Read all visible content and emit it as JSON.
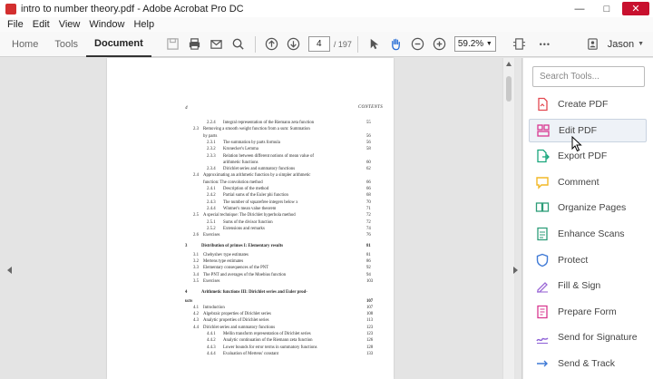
{
  "window": {
    "title": "intro to number theory.pdf - Adobe Acrobat Pro DC",
    "minimize": "—",
    "maximize": "□",
    "close": "✕"
  },
  "menu": [
    "File",
    "Edit",
    "View",
    "Window",
    "Help"
  ],
  "toolbar": {
    "tabs": [
      "Home",
      "Tools",
      "Document"
    ],
    "active_tab": "Document",
    "page_current": "4",
    "page_total": "/ 197",
    "zoom": "59.2%",
    "more": "•••",
    "user": "Jason"
  },
  "document": {
    "page_number": "4",
    "running_title": "CONTENTS",
    "toc": [
      {
        "num": "2.2.4",
        "title": "Integral representation of the Riemann zeta function",
        "page": "55",
        "level": 3
      },
      {
        "num": "2.3",
        "title": "Removing a smooth weight function from a sum: Summation",
        "page": "",
        "level": 2
      },
      {
        "num": "",
        "title": "by parts",
        "page": "56",
        "level": 2
      },
      {
        "num": "2.3.1",
        "title": "The summation by parts formula",
        "page": "56",
        "level": 3
      },
      {
        "num": "2.3.2",
        "title": "Kronecker's Lemma",
        "page": "58",
        "level": 3
      },
      {
        "num": "2.3.3",
        "title": "Relation between different notions of mean value of",
        "page": "",
        "level": 3
      },
      {
        "num": "",
        "title": "arithmetic functions",
        "page": "60",
        "level": 3
      },
      {
        "num": "2.3.4",
        "title": "Dirichlet series and summatory functions",
        "page": "62",
        "level": 3
      },
      {
        "num": "2.4",
        "title": "Approximating an arithmetic function by a simpler arithmetic",
        "page": "",
        "level": 2
      },
      {
        "num": "",
        "title": "function: The convolution method",
        "page": "66",
        "level": 2
      },
      {
        "num": "2.4.1",
        "title": "Description of the method",
        "page": "66",
        "level": 3
      },
      {
        "num": "2.4.2",
        "title": "Partial sums of the Euler phi function",
        "page": "68",
        "level": 3
      },
      {
        "num": "2.4.3",
        "title": "The number of squarefree integers below x",
        "page": "70",
        "level": 3
      },
      {
        "num": "2.4.4",
        "title": "Wintner's mean value theorem",
        "page": "71",
        "level": 3
      },
      {
        "num": "2.5",
        "title": "A special technique: The Dirichlet hyperbola method",
        "page": "72",
        "level": 2
      },
      {
        "num": "2.5.1",
        "title": "Sums of the divisor function",
        "page": "72",
        "level": 3
      },
      {
        "num": "2.5.2",
        "title": "Extensions and remarks",
        "page": "74",
        "level": 3
      },
      {
        "num": "2.6",
        "title": "Exercises",
        "page": "76",
        "level": 2
      },
      {
        "num": "3",
        "title": "Distribution of primes I: Elementary results",
        "page": "81",
        "level": 1
      },
      {
        "num": "3.1",
        "title": "Chebyshev type estimates",
        "page": "81",
        "level": 2
      },
      {
        "num": "3.2",
        "title": "Mertens type estimates",
        "page": "86",
        "level": 2
      },
      {
        "num": "3.3",
        "title": "Elementary consequences of the PNT",
        "page": "92",
        "level": 2
      },
      {
        "num": "3.4",
        "title": "The PNT and averages of the Moebius function",
        "page": "94",
        "level": 2
      },
      {
        "num": "3.5",
        "title": "Exercises",
        "page": "103",
        "level": 2
      },
      {
        "num": "4",
        "title": "Arithmetic functions III: Dirichlet series and Euler prod-",
        "page": "",
        "level": 1
      },
      {
        "num": "",
        "title": "ucts",
        "page": "107",
        "level": 1
      },
      {
        "num": "4.1",
        "title": "Introduction",
        "page": "107",
        "level": 2
      },
      {
        "num": "4.2",
        "title": "Algebraic properties of Dirichlet series",
        "page": "108",
        "level": 2
      },
      {
        "num": "4.3",
        "title": "Analytic properties of Dirichlet series",
        "page": "113",
        "level": 2
      },
      {
        "num": "4.4",
        "title": "Dirichlet series and summatory functions",
        "page": "123",
        "level": 2
      },
      {
        "num": "4.4.1",
        "title": "Mellin transform representation of Dirichlet series",
        "page": "123",
        "level": 3
      },
      {
        "num": "4.4.2",
        "title": "Analytic continuation of the Riemann zeta function",
        "page": "126",
        "level": 3
      },
      {
        "num": "4.4.3",
        "title": "Lower bounds for error terms in summatory functions",
        "page": "128",
        "level": 3
      },
      {
        "num": "4.4.4",
        "title": "Evaluation of Mertens' constant",
        "page": "133",
        "level": 3
      }
    ]
  },
  "tools_panel": {
    "search_placeholder": "Search Tools...",
    "items": [
      {
        "label": "Create PDF",
        "icon": "create-pdf-icon",
        "color": "#e34850"
      },
      {
        "label": "Edit PDF",
        "icon": "edit-pdf-icon",
        "color": "#d83790"
      },
      {
        "label": "Export PDF",
        "icon": "export-pdf-icon",
        "color": "#19a67c"
      },
      {
        "label": "Comment",
        "icon": "comment-icon",
        "color": "#f2b827"
      },
      {
        "label": "Organize Pages",
        "icon": "organize-pages-icon",
        "color": "#2d9d78"
      },
      {
        "label": "Enhance Scans",
        "icon": "enhance-scans-icon",
        "color": "#2d9d78"
      },
      {
        "label": "Protect",
        "icon": "protect-icon",
        "color": "#3f7ad6"
      },
      {
        "label": "Fill & Sign",
        "icon": "fill-sign-icon",
        "color": "#9b68d6"
      },
      {
        "label": "Prepare Form",
        "icon": "prepare-form-icon",
        "color": "#d83790"
      },
      {
        "label": "Send for Signature",
        "icon": "send-signature-icon",
        "color": "#8c5fd6"
      },
      {
        "label": "Send & Track",
        "icon": "send-track-icon",
        "color": "#3f7ad6"
      }
    ],
    "hovered": "Edit PDF"
  }
}
